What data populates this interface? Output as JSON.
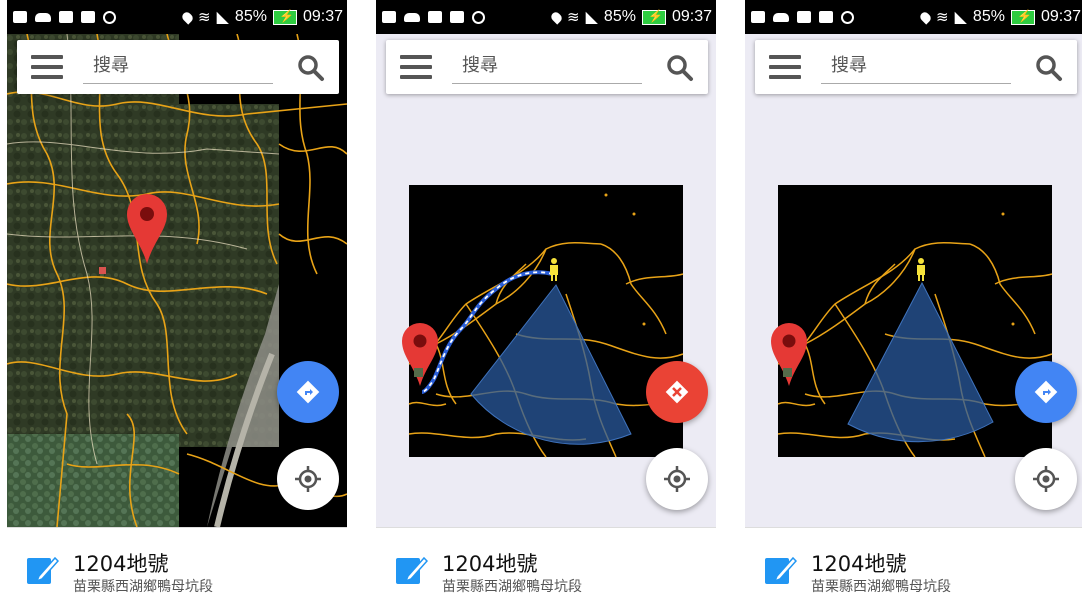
{
  "screens": [
    {
      "status": {
        "battery": "85%",
        "time": "09:37"
      },
      "search": {
        "placeholder": "搜尋"
      },
      "map_mode": "satellite",
      "fab_primary": "directions",
      "info": {
        "title": "1204地號",
        "subtitle": "苗栗縣西湖鄉鴨母坑段"
      }
    },
    {
      "status": {
        "battery": "85%",
        "time": "09:37"
      },
      "search": {
        "placeholder": "搜尋"
      },
      "map_mode": "overview-with-route",
      "fab_primary": "cancel-navigation",
      "info": {
        "title": "1204地號",
        "subtitle": "苗栗縣西湖鄉鴨母坑段"
      }
    },
    {
      "status": {
        "battery": "85%",
        "time": "09:37"
      },
      "search": {
        "placeholder": "搜尋"
      },
      "map_mode": "overview",
      "fab_primary": "directions",
      "info": {
        "title": "1204地號",
        "subtitle": "苗栗縣西湖鄉鴨母坑段"
      }
    }
  ],
  "colors": {
    "boundary": "#e8a317",
    "directions_fab": "#4285f4",
    "cancel_fab": "#ea4335",
    "marker": "#e53935",
    "note_icon": "#2196f3",
    "view_cone": "#2a5a9e"
  }
}
